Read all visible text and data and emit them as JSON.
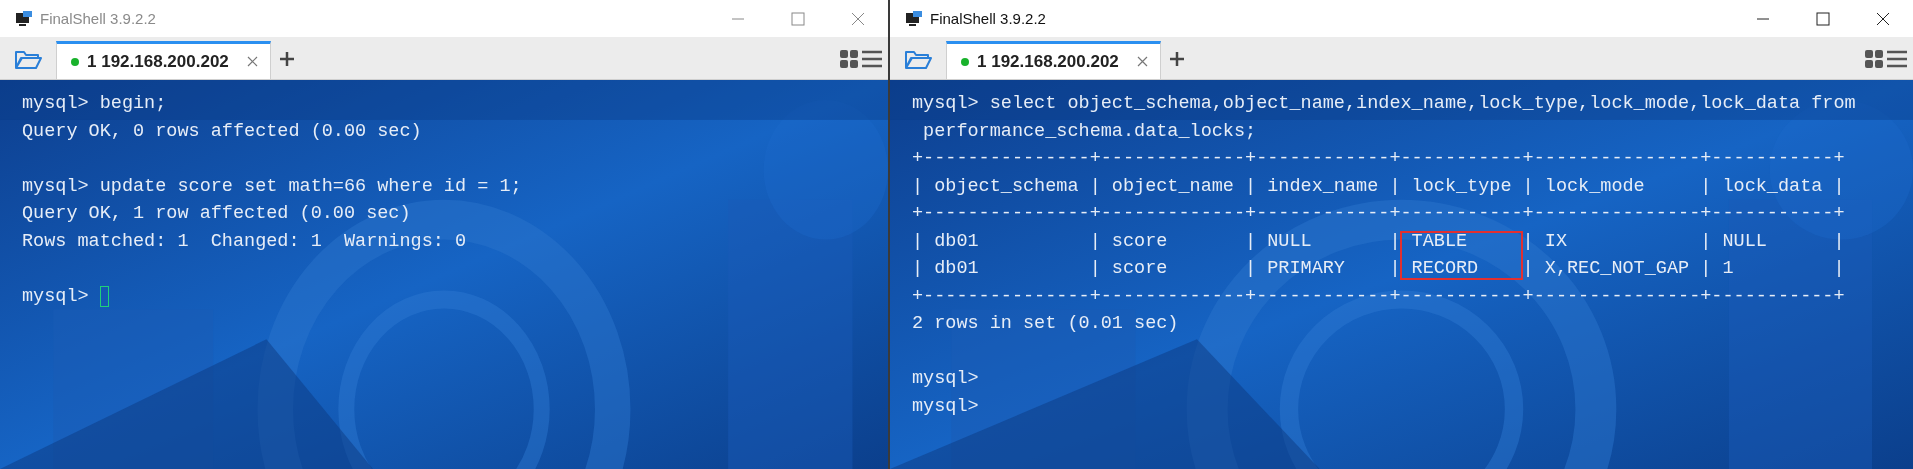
{
  "windows": [
    {
      "title": "FinalShell 3.9.2.2",
      "active": false,
      "tabs": [
        {
          "label": "1 192.168.200.202",
          "selected": true,
          "connected": true
        }
      ],
      "terminal": {
        "lines": [
          {
            "kind": "text",
            "text": "mysql> begin;"
          },
          {
            "kind": "text",
            "text": "Query OK, 0 rows affected (0.00 sec)"
          },
          {
            "kind": "blank"
          },
          {
            "kind": "text",
            "text": "mysql> update score set math=66 where id = 1;"
          },
          {
            "kind": "text",
            "text": "Query OK, 1 row affected (0.00 sec)"
          },
          {
            "kind": "text",
            "text": "Rows matched: 1  Changed: 1  Warnings: 0"
          },
          {
            "kind": "blank"
          },
          {
            "kind": "prompt",
            "text": "mysql>",
            "cursor": true
          }
        ]
      }
    },
    {
      "title": "FinalShell 3.9.2.2",
      "active": true,
      "tabs": [
        {
          "label": "1 192.168.200.202",
          "selected": true,
          "connected": true
        }
      ],
      "terminal": {
        "lines": [
          {
            "kind": "text",
            "text": "mysql> select object_schema,object_name,index_name,lock_type,lock_mode,lock_data from"
          },
          {
            "kind": "text",
            "text": " performance_schema.data_locks;"
          },
          {
            "kind": "text",
            "text": "+---------------+-------------+------------+-----------+---------------+-----------+"
          },
          {
            "kind": "text",
            "text": "| object_schema | object_name | index_name | lock_type | lock_mode     | lock_data |"
          },
          {
            "kind": "text",
            "text": "+---------------+-------------+------------+-----------+---------------+-----------+"
          },
          {
            "kind": "row",
            "before": "| db01          | score       | NULL       |",
            "cell": " TABLE     ",
            "after": "| IX            | NULL      |",
            "highlighted": true
          },
          {
            "kind": "row",
            "before": "| db01          | score       | PRIMARY    |",
            "cell": " RECORD    ",
            "after": "| X,REC_NOT_GAP | 1         |",
            "highlighted": true
          },
          {
            "kind": "text",
            "text": "+---------------+-------------+------------+-----------+---------------+-----------+"
          },
          {
            "kind": "text",
            "text": "2 rows in set (0.01 sec)"
          },
          {
            "kind": "blank"
          },
          {
            "kind": "prompt",
            "text": "mysql>"
          },
          {
            "kind": "prompt",
            "text": "mysql>"
          }
        ]
      }
    }
  ]
}
